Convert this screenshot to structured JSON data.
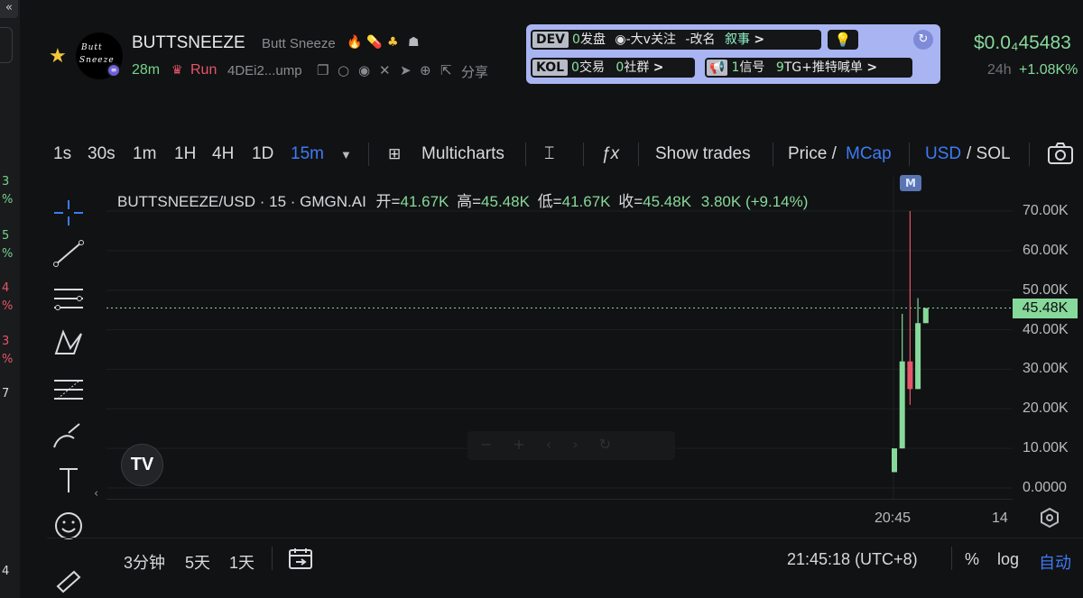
{
  "left_strip": {
    "top_glyph": "«",
    "items": [
      {
        "num": "3",
        "pct": "%",
        "color": "#74d38c"
      },
      {
        "num": "5",
        "pct": "%",
        "color": "#74d38c"
      },
      {
        "num": "4",
        "pct": "%",
        "color": "#e5566a"
      },
      {
        "num": "3",
        "pct": "%",
        "color": "#e5566a"
      },
      {
        "num": "7",
        "pct": "",
        "color": "#d8d9dc"
      },
      {
        "num": "4",
        "pct": "",
        "color": "#d8d9dc"
      }
    ]
  },
  "token": {
    "symbol": "BUTTSNEEZE",
    "name": "Butt Sneeze",
    "avatar_line1": "Butt",
    "avatar_line2": "Sneeze",
    "age": "28m",
    "run_label": "Run",
    "address": "4DEi2...ump",
    "share_label": "分享"
  },
  "dev_panel": {
    "dev_tag": "DEV",
    "dev_count": "0",
    "dev_label": "发盘",
    "twitter_label": "-大v关注",
    "rename_label": "-改名",
    "narrative_label": "叙事",
    "kol_tag": "KOL",
    "kol_count": "0",
    "kol_label": "交易",
    "community_count": "0",
    "community_label": "社群",
    "signal_count": "1",
    "signal_label": "信号",
    "tg_count": "9",
    "tg_label": "TG+推特喊单",
    "arrow": ">"
  },
  "price": {
    "value": "$0.0₄45483",
    "change_label": "24h",
    "change_value": "+1.08K%"
  },
  "toolbar": {
    "intervals": [
      "1s",
      "30s",
      "1m",
      "1H",
      "4H",
      "1D",
      "15m"
    ],
    "active_interval": "15m",
    "multicharts": "Multicharts",
    "show_trades": "Show trades",
    "price_label": "Price /",
    "mcap_label": "MCap",
    "usd_label": "USD",
    "sol_label": "/ SOL"
  },
  "legend": {
    "pair": "BUTTSNEEZE/USD · 15 · GMGN.AI",
    "open_k": "开=",
    "open_v": "41.67K",
    "high_k": "高=",
    "high_v": "45.48K",
    "low_k": "低=",
    "low_v": "41.67K",
    "close_k": "收=",
    "close_v": "45.48K",
    "change": "3.80K (+9.14%)"
  },
  "chart_data": {
    "type": "candlestick",
    "ylim": [
      0,
      75000
    ],
    "yticks": [
      "70.00K",
      "60.00K",
      "50.00K",
      "40.00K",
      "30.00K",
      "20.00K",
      "10.00K",
      "0.0000"
    ],
    "xticks": [
      "20:45",
      "14"
    ],
    "last_price_label": "45.48K",
    "last_price": 45480,
    "marker": "M",
    "candles": [
      {
        "o": 4000,
        "h": 10000,
        "l": 4000,
        "c": 10000
      },
      {
        "o": 10000,
        "h": 44000,
        "l": 10000,
        "c": 32000
      },
      {
        "o": 32000,
        "h": 70000,
        "l": 21000,
        "c": 25000
      },
      {
        "o": 25000,
        "h": 48000,
        "l": 25000,
        "c": 41670
      },
      {
        "o": 41670,
        "h": 45480,
        "l": 41670,
        "c": 45480
      }
    ],
    "up_color": "#86d99b",
    "down_color": "#e5566a"
  },
  "watermark": "TV",
  "bottom": {
    "ranges": [
      "3分钟",
      "5天",
      "1天"
    ],
    "time": "21:45:18 (UTC+8)",
    "percent": "%",
    "log": "log",
    "auto": "自动"
  }
}
